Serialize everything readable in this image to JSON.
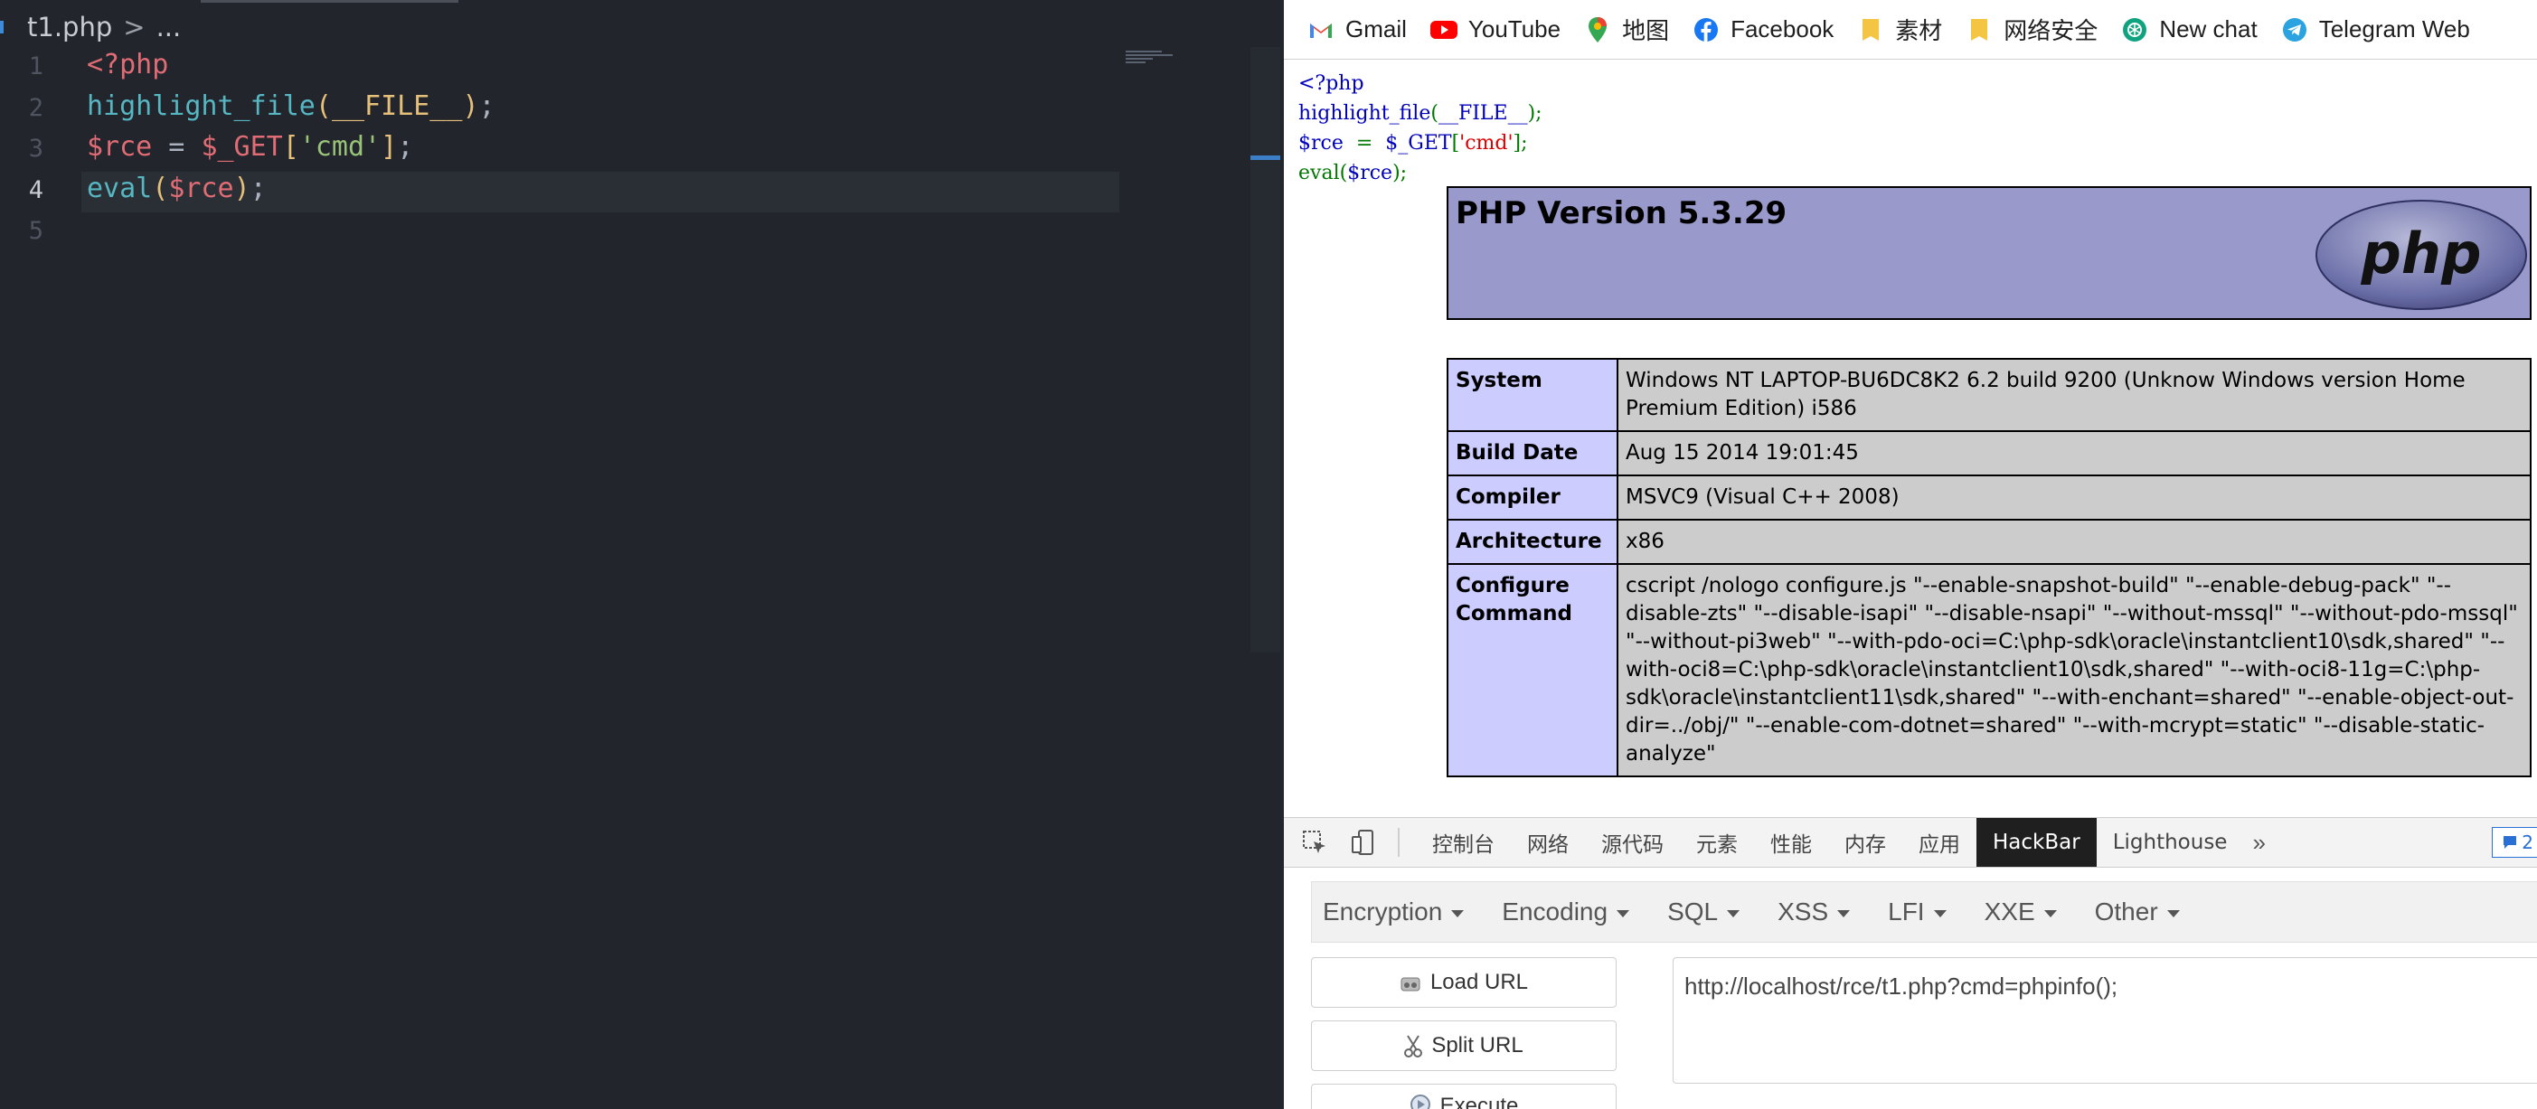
{
  "editor": {
    "breadcrumb": {
      "file": "t1.php",
      "chevron": ">",
      "rest": "..."
    },
    "current_line": 4,
    "lines": [
      {
        "num": "1",
        "tokens": [
          {
            "t": "<?php",
            "c": "tk-red"
          }
        ]
      },
      {
        "num": "2",
        "tokens": [
          {
            "t": "highlight_file",
            "c": "tk-cyan"
          },
          {
            "t": "(",
            "c": "tk-yellow"
          },
          {
            "t": "__FILE__",
            "c": "tk-yellow"
          },
          {
            "t": ")",
            "c": "tk-yellow"
          },
          {
            "t": ";",
            "c": "tk-default"
          }
        ]
      },
      {
        "num": "3",
        "tokens": [
          {
            "t": "$rce",
            "c": "tk-red"
          },
          {
            "t": " = ",
            "c": "tk-default"
          },
          {
            "t": "$_GET",
            "c": "tk-red"
          },
          {
            "t": "[",
            "c": "tk-yellow"
          },
          {
            "t": "'cmd'",
            "c": "tk-green"
          },
          {
            "t": "]",
            "c": "tk-yellow"
          },
          {
            "t": ";",
            "c": "tk-default"
          }
        ]
      },
      {
        "num": "4",
        "tokens": [
          {
            "t": "eval",
            "c": "tk-cyan"
          },
          {
            "t": "(",
            "c": "tk-yellow"
          },
          {
            "t": "$rce",
            "c": "tk-red"
          },
          {
            "t": ")",
            "c": "tk-yellow"
          },
          {
            "t": ";",
            "c": "tk-default"
          }
        ]
      },
      {
        "num": "5",
        "tokens": []
      }
    ]
  },
  "bookmarks": [
    {
      "label": "Gmail",
      "icon": "gmail-icon"
    },
    {
      "label": "YouTube",
      "icon": "youtube-icon"
    },
    {
      "label": "地图",
      "icon": "maps-icon"
    },
    {
      "label": "Facebook",
      "icon": "facebook-icon"
    },
    {
      "label": "素材",
      "icon": "folder-icon"
    },
    {
      "label": "网络安全",
      "icon": "folder-icon"
    },
    {
      "label": "New chat",
      "icon": "chatgpt-icon"
    },
    {
      "label": "Telegram Web",
      "icon": "telegram-icon"
    }
  ],
  "page": {
    "source_lines": [
      [
        {
          "t": "<?php",
          "c": "src-blue"
        }
      ],
      [
        {
          "t": "highlight_file",
          "c": "src-blue"
        },
        {
          "t": "(",
          "c": "src-green"
        },
        {
          "t": "__FILE__",
          "c": "src-blue"
        },
        {
          "t": ");",
          "c": "src-green"
        }
      ],
      [
        {
          "t": "$rce  ",
          "c": "src-blue"
        },
        {
          "t": "=  ",
          "c": "src-green"
        },
        {
          "t": "$_GET",
          "c": "src-blue"
        },
        {
          "t": "[",
          "c": "src-green"
        },
        {
          "t": "'cmd'",
          "c": "src-red"
        },
        {
          "t": "];",
          "c": "src-green"
        }
      ],
      [
        {
          "t": "eval",
          "c": "src-green"
        },
        {
          "t": "(",
          "c": "src-green"
        },
        {
          "t": "$rce",
          "c": "src-blue"
        },
        {
          "t": ");",
          "c": "src-green"
        }
      ]
    ],
    "php_title": "PHP Version 5.3.29",
    "php_logo_text": "php",
    "info_rows": [
      {
        "key": "System",
        "value": "Windows NT LAPTOP-BU6DC8K2 6.2 build 9200 (Unknow Windows version Home Premium Edition) i586"
      },
      {
        "key": "Build Date",
        "value": "Aug 15 2014 19:01:45"
      },
      {
        "key": "Compiler",
        "value": "MSVC9 (Visual C++ 2008)"
      },
      {
        "key": "Architecture",
        "value": "x86"
      },
      {
        "key": "Configure Command",
        "value": "cscript /nologo configure.js \"--enable-snapshot-build\" \"--enable-debug-pack\" \"--disable-zts\" \"--disable-isapi\" \"--disable-nsapi\" \"--without-mssql\" \"--without-pdo-mssql\" \"--without-pi3web\" \"--with-pdo-oci=C:\\php-sdk\\oracle\\instantclient10\\sdk,shared\" \"--with-oci8=C:\\php-sdk\\oracle\\instantclient10\\sdk,shared\" \"--with-oci8-11g=C:\\php-sdk\\oracle\\instantclient11\\sdk,shared\" \"--with-enchant=shared\" \"--enable-object-out-dir=../obj/\" \"--enable-com-dotnet=shared\" \"--with-mcrypt=static\" \"--disable-static-analyze\""
      }
    ]
  },
  "devtools": {
    "tabs": [
      {
        "label": "控制台",
        "active": false
      },
      {
        "label": "网络",
        "active": false
      },
      {
        "label": "源代码",
        "active": false
      },
      {
        "label": "元素",
        "active": false
      },
      {
        "label": "性能",
        "active": false
      },
      {
        "label": "内存",
        "active": false
      },
      {
        "label": "应用",
        "active": false
      },
      {
        "label": "HackBar",
        "active": true
      },
      {
        "label": "Lighthouse",
        "active": false
      }
    ],
    "more": "»",
    "badge": "2"
  },
  "hackbar": {
    "menu": [
      "Encryption",
      "Encoding",
      "SQL",
      "XSS",
      "LFI",
      "XXE",
      "Other"
    ],
    "load_url": "Load URL",
    "split_url": "Split URL",
    "execute": "Execute",
    "url_value": "http://localhost/rce/t1.php?cmd=phpinfo();"
  }
}
